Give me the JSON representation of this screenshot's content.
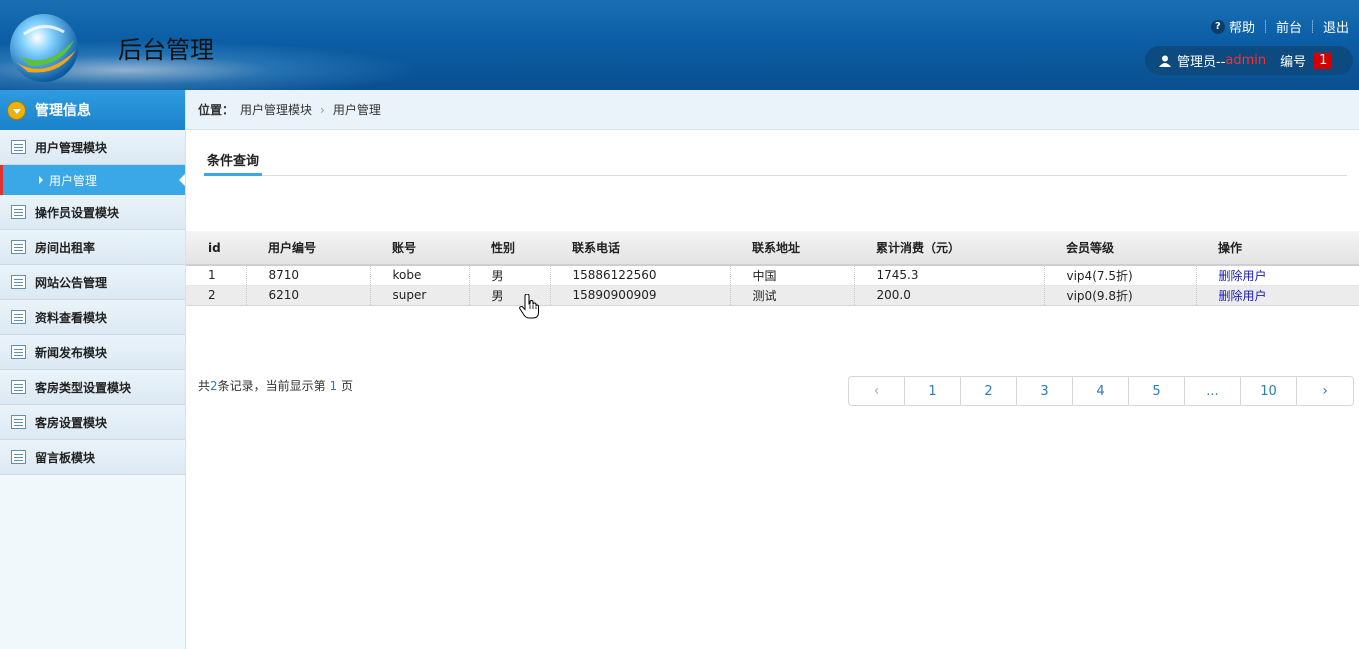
{
  "header": {
    "title": "后台管理",
    "links": {
      "help": "帮助",
      "front": "前台",
      "logout": "退出"
    },
    "help_icon_glyph": "?",
    "user": {
      "role_prefix": "管理员--",
      "username": "admin",
      "number_label": "编号",
      "number_value": "1"
    }
  },
  "sidebar": {
    "heading": "管理信息",
    "items": [
      {
        "label": "用户管理模块"
      },
      {
        "label": "操作员设置模块"
      },
      {
        "label": "房间出租率"
      },
      {
        "label": "网站公告管理"
      },
      {
        "label": "资料查看模块"
      },
      {
        "label": "新闻发布模块"
      },
      {
        "label": "客房类型设置模块"
      },
      {
        "label": "客房设置模块"
      },
      {
        "label": "留言板模块"
      }
    ],
    "active_sub_item": "用户管理"
  },
  "breadcrumb": {
    "label": "位置：",
    "items": [
      "用户管理模块",
      "用户管理"
    ],
    "separator": "›"
  },
  "query_tab": {
    "label": "条件查询"
  },
  "table": {
    "columns": [
      "id",
      "用户编号",
      "账号",
      "性别",
      "联系电话",
      "联系地址",
      "累计消费（元）",
      "会员等级",
      "操作"
    ],
    "rows": [
      {
        "id": "1",
        "user_no": "8710",
        "account": "kobe",
        "gender": "男",
        "phone": "15886122560",
        "address": "中国",
        "spent": "1745.3",
        "level": "vip4(7.5折)",
        "action": "删除用户"
      },
      {
        "id": "2",
        "user_no": "6210",
        "account": "super",
        "gender": "男",
        "phone": "15890900909",
        "address": "测试",
        "spent": "200.0",
        "level": "vip0(9.8折)",
        "action": "删除用户"
      }
    ]
  },
  "summary": {
    "prefix": "共",
    "count": "2",
    "middle": "条记录，当前显示第",
    "page": "1",
    "suffix": "页"
  },
  "pager": {
    "prev": "‹",
    "pages": [
      "1",
      "2",
      "3",
      "4",
      "5",
      "...",
      "10"
    ],
    "next": "›"
  },
  "colors": {
    "header_blue": "#0b5ea5",
    "sidebar_active": "#3aa8e6",
    "admin_red": "#ff2d2d",
    "badge_red": "#d40000",
    "link_blue": "#1a1ab8"
  }
}
